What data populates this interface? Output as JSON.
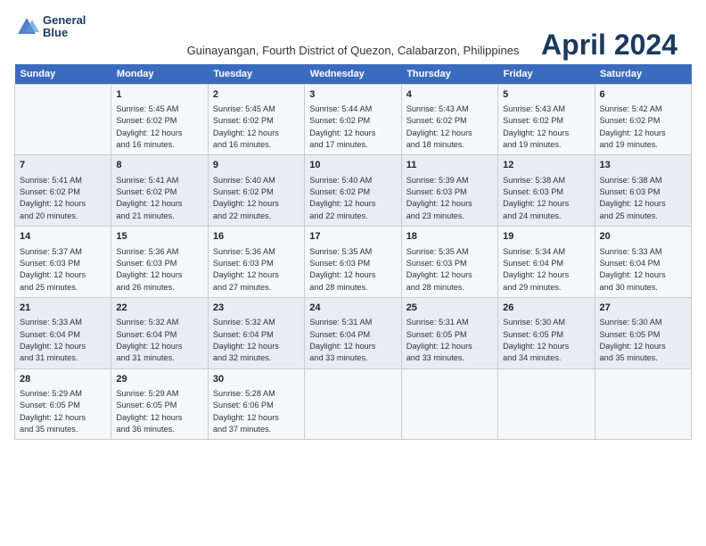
{
  "logo": {
    "line1": "General",
    "line2": "Blue"
  },
  "title": "April 2024",
  "subtitle": "Guinayangan, Fourth District of Quezon, Calabarzon, Philippines",
  "days_of_week": [
    "Sunday",
    "Monday",
    "Tuesday",
    "Wednesday",
    "Thursday",
    "Friday",
    "Saturday"
  ],
  "weeks": [
    [
      {
        "day": "",
        "info": ""
      },
      {
        "day": "1",
        "info": "Sunrise: 5:45 AM\nSunset: 6:02 PM\nDaylight: 12 hours\nand 16 minutes."
      },
      {
        "day": "2",
        "info": "Sunrise: 5:45 AM\nSunset: 6:02 PM\nDaylight: 12 hours\nand 16 minutes."
      },
      {
        "day": "3",
        "info": "Sunrise: 5:44 AM\nSunset: 6:02 PM\nDaylight: 12 hours\nand 17 minutes."
      },
      {
        "day": "4",
        "info": "Sunrise: 5:43 AM\nSunset: 6:02 PM\nDaylight: 12 hours\nand 18 minutes."
      },
      {
        "day": "5",
        "info": "Sunrise: 5:43 AM\nSunset: 6:02 PM\nDaylight: 12 hours\nand 19 minutes."
      },
      {
        "day": "6",
        "info": "Sunrise: 5:42 AM\nSunset: 6:02 PM\nDaylight: 12 hours\nand 19 minutes."
      }
    ],
    [
      {
        "day": "7",
        "info": "Sunrise: 5:41 AM\nSunset: 6:02 PM\nDaylight: 12 hours\nand 20 minutes."
      },
      {
        "day": "8",
        "info": "Sunrise: 5:41 AM\nSunset: 6:02 PM\nDaylight: 12 hours\nand 21 minutes."
      },
      {
        "day": "9",
        "info": "Sunrise: 5:40 AM\nSunset: 6:02 PM\nDaylight: 12 hours\nand 22 minutes."
      },
      {
        "day": "10",
        "info": "Sunrise: 5:40 AM\nSunset: 6:02 PM\nDaylight: 12 hours\nand 22 minutes."
      },
      {
        "day": "11",
        "info": "Sunrise: 5:39 AM\nSunset: 6:03 PM\nDaylight: 12 hours\nand 23 minutes."
      },
      {
        "day": "12",
        "info": "Sunrise: 5:38 AM\nSunset: 6:03 PM\nDaylight: 12 hours\nand 24 minutes."
      },
      {
        "day": "13",
        "info": "Sunrise: 5:38 AM\nSunset: 6:03 PM\nDaylight: 12 hours\nand 25 minutes."
      }
    ],
    [
      {
        "day": "14",
        "info": "Sunrise: 5:37 AM\nSunset: 6:03 PM\nDaylight: 12 hours\nand 25 minutes."
      },
      {
        "day": "15",
        "info": "Sunrise: 5:36 AM\nSunset: 6:03 PM\nDaylight: 12 hours\nand 26 minutes."
      },
      {
        "day": "16",
        "info": "Sunrise: 5:36 AM\nSunset: 6:03 PM\nDaylight: 12 hours\nand 27 minutes."
      },
      {
        "day": "17",
        "info": "Sunrise: 5:35 AM\nSunset: 6:03 PM\nDaylight: 12 hours\nand 28 minutes."
      },
      {
        "day": "18",
        "info": "Sunrise: 5:35 AM\nSunset: 6:03 PM\nDaylight: 12 hours\nand 28 minutes."
      },
      {
        "day": "19",
        "info": "Sunrise: 5:34 AM\nSunset: 6:04 PM\nDaylight: 12 hours\nand 29 minutes."
      },
      {
        "day": "20",
        "info": "Sunrise: 5:33 AM\nSunset: 6:04 PM\nDaylight: 12 hours\nand 30 minutes."
      }
    ],
    [
      {
        "day": "21",
        "info": "Sunrise: 5:33 AM\nSunset: 6:04 PM\nDaylight: 12 hours\nand 31 minutes."
      },
      {
        "day": "22",
        "info": "Sunrise: 5:32 AM\nSunset: 6:04 PM\nDaylight: 12 hours\nand 31 minutes."
      },
      {
        "day": "23",
        "info": "Sunrise: 5:32 AM\nSunset: 6:04 PM\nDaylight: 12 hours\nand 32 minutes."
      },
      {
        "day": "24",
        "info": "Sunrise: 5:31 AM\nSunset: 6:04 PM\nDaylight: 12 hours\nand 33 minutes."
      },
      {
        "day": "25",
        "info": "Sunrise: 5:31 AM\nSunset: 6:05 PM\nDaylight: 12 hours\nand 33 minutes."
      },
      {
        "day": "26",
        "info": "Sunrise: 5:30 AM\nSunset: 6:05 PM\nDaylight: 12 hours\nand 34 minutes."
      },
      {
        "day": "27",
        "info": "Sunrise: 5:30 AM\nSunset: 6:05 PM\nDaylight: 12 hours\nand 35 minutes."
      }
    ],
    [
      {
        "day": "28",
        "info": "Sunrise: 5:29 AM\nSunset: 6:05 PM\nDaylight: 12 hours\nand 35 minutes."
      },
      {
        "day": "29",
        "info": "Sunrise: 5:29 AM\nSunset: 6:05 PM\nDaylight: 12 hours\nand 36 minutes."
      },
      {
        "day": "30",
        "info": "Sunrise: 5:28 AM\nSunset: 6:06 PM\nDaylight: 12 hours\nand 37 minutes."
      },
      {
        "day": "",
        "info": ""
      },
      {
        "day": "",
        "info": ""
      },
      {
        "day": "",
        "info": ""
      },
      {
        "day": "",
        "info": ""
      }
    ]
  ]
}
